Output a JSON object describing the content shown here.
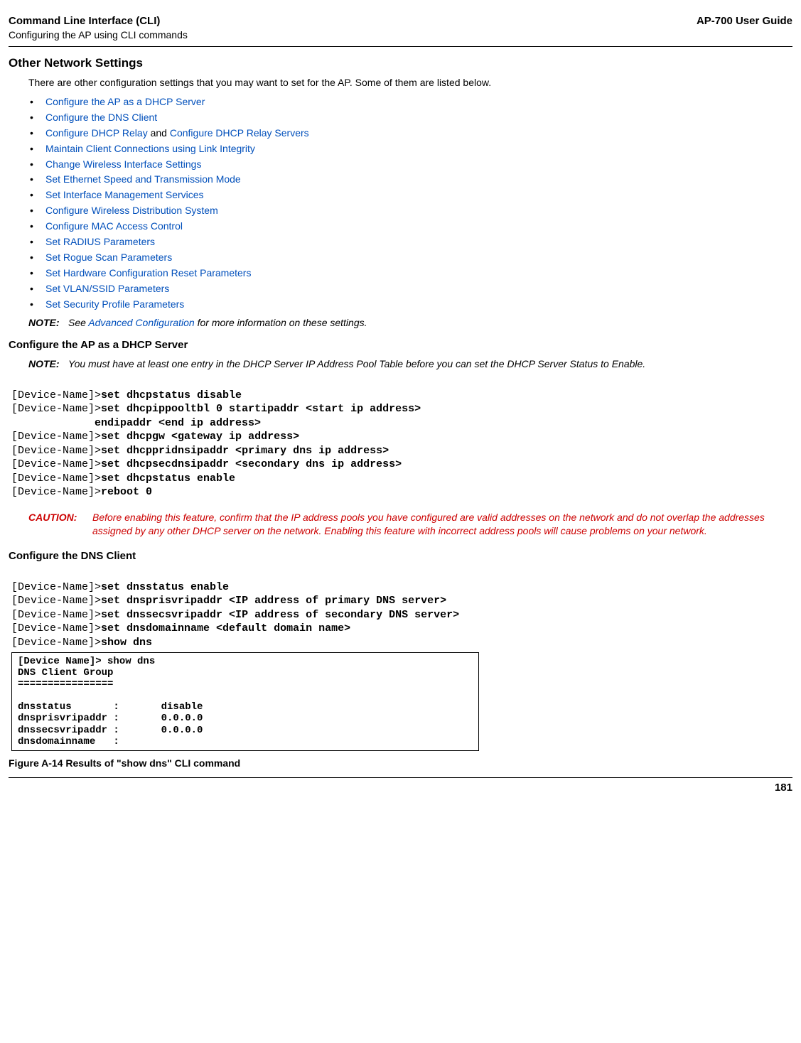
{
  "header": {
    "title": "Command Line Interface (CLI)",
    "subtitle": "Configuring the AP using CLI commands",
    "userGuide": "AP-700 User Guide"
  },
  "section": {
    "title": "Other Network Settings",
    "intro": "There are other configuration settings that you may want to set for the AP. Some of them are listed below."
  },
  "links": [
    {
      "text": "Configure the AP as a DHCP Server",
      "plain": ""
    },
    {
      "text": "Configure the DNS Client",
      "plain": ""
    },
    {
      "text": "Configure DHCP Relay",
      "plain": " and ",
      "text2": "Configure DHCP Relay Servers"
    },
    {
      "text": "Maintain Client Connections using Link Integrity",
      "plain": ""
    },
    {
      "text": "Change Wireless Interface Settings",
      "plain": ""
    },
    {
      "text": "Set Ethernet Speed and Transmission Mode",
      "plain": ""
    },
    {
      "text": "Set Interface Management Services",
      "plain": ""
    },
    {
      "text": "Configure Wireless Distribution System",
      "plain": ""
    },
    {
      "text": "Configure MAC Access Control",
      "plain": ""
    },
    {
      "text": "Set RADIUS Parameters",
      "plain": ""
    },
    {
      "text": "Set Rogue Scan Parameters",
      "plain": ""
    },
    {
      "text": "Set Hardware Configuration Reset Parameters",
      "plain": ""
    },
    {
      "text": "Set VLAN/SSID Parameters",
      "plain": ""
    },
    {
      "text": "Set Security Profile Parameters",
      "plain": ""
    }
  ],
  "note1": {
    "label": "NOTE:",
    "prefix": "See ",
    "link": "Advanced Configuration",
    "suffix": " for more information on these settings."
  },
  "dhcp": {
    "title": "Configure the AP as a DHCP Server",
    "note": {
      "label": "NOTE:",
      "text": "You must have at least one entry in the DHCP Server IP Address Pool Table before you can set the DHCP Server Status to Enable."
    },
    "cli": {
      "prompt": "[Device-Name]>",
      "l1": "set dhcpstatus disable",
      "l2": "set dhcpippooltbl 0 startipaddr <start ip address>",
      "l3": "             endipaddr <end ip address>",
      "l4": "set dhcpgw <gateway ip address>",
      "l5": "set dhcppridnsipaddr <primary dns ip address>",
      "l6": "set dhcpsecdnsipaddr <secondary dns ip address>",
      "l7": "set dhcpstatus enable",
      "l8": "reboot 0"
    }
  },
  "caution": {
    "label": "CAUTION:",
    "text": "Before enabling this feature, confirm that the IP address pools you have configured are valid addresses on the network and do not overlap the addresses assigned by any other DHCP server on the network. Enabling this feature with incorrect address pools will cause problems on your network."
  },
  "dns": {
    "title": "Configure the DNS Client",
    "cli": {
      "prompt": "[Device-Name]>",
      "l1": "set dnsstatus enable",
      "l2": "set dnsprisvripaddr <IP address of primary DNS server>",
      "l3": "set dnssecsvripaddr <IP address of secondary DNS server>",
      "l4": "set dnsdomainname <default domain name>",
      "l5": "show dns"
    },
    "result": "[Device Name]> show dns\nDNS Client Group\n================\n\ndnsstatus       :       disable\ndnsprisvripaddr :       0.0.0.0\ndnssecsvripaddr :       0.0.0.0\ndnsdomainname   :",
    "figure": "Figure A-14 Results of \"show dns\" CLI command"
  },
  "footer": {
    "page": "181"
  }
}
